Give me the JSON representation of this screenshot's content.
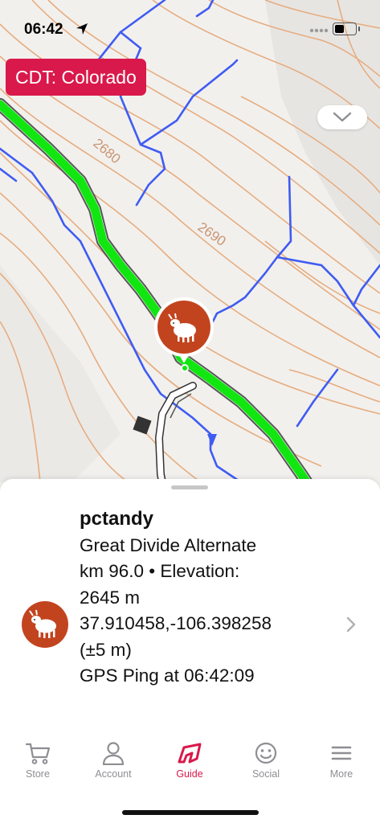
{
  "status_bar": {
    "time": "06:42"
  },
  "map": {
    "region_label": "CDT: Colorado",
    "contour_labels": [
      "2680",
      "2690"
    ],
    "colors": {
      "trail": "#11e611",
      "contour": "#e3a878",
      "water": "#3b5bf5",
      "marker": "#c2441f"
    }
  },
  "detail": {
    "user": "pctandy",
    "route": "Great Divide Alternate",
    "km_elevation": "km 96.0 • Elevation:",
    "elevation": "2645 m",
    "coordinates": "37.910458,-106.398258",
    "accuracy": "(±5 m)",
    "gps_ping": "GPS Ping at 06:42:09"
  },
  "tabs": [
    {
      "label": "Store",
      "icon": "cart-icon",
      "active": false
    },
    {
      "label": "Account",
      "icon": "person-icon",
      "active": false
    },
    {
      "label": "Guide",
      "icon": "guide-logo-icon",
      "active": true
    },
    {
      "label": "Social",
      "icon": "smiley-icon",
      "active": false
    },
    {
      "label": "More",
      "icon": "menu-icon",
      "active": false
    }
  ]
}
